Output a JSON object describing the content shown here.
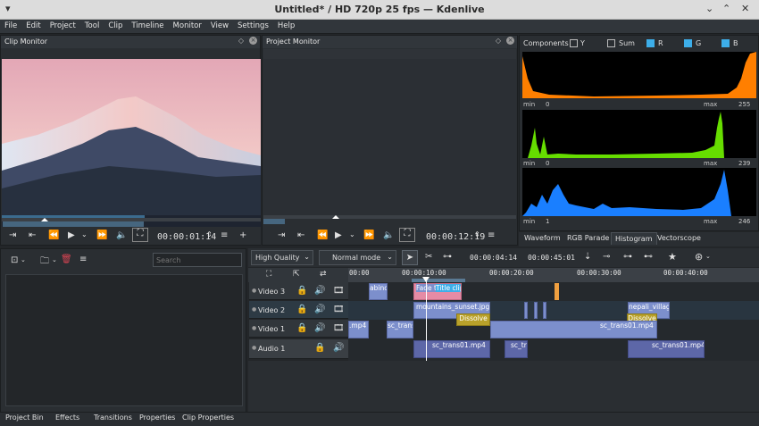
{
  "window": {
    "title": "Untitled* / HD 720p 25 fps — Kdenlive"
  },
  "menu": [
    "File",
    "Edit",
    "Project",
    "Tool",
    "Clip",
    "Timeline",
    "Monitor",
    "View",
    "Settings",
    "Help"
  ],
  "clip_monitor": {
    "title": "Clip Monitor",
    "timecode": "00:00:01:14"
  },
  "project_monitor": {
    "title": "Project Monitor",
    "timecode": "00:00:12:19"
  },
  "scopes": {
    "components_label": "Components",
    "checks": [
      {
        "label": "Y",
        "checked": false
      },
      {
        "label": "Sum",
        "checked": false
      },
      {
        "label": "R",
        "checked": true
      },
      {
        "label": "G",
        "checked": true
      },
      {
        "label": "B",
        "checked": true
      }
    ],
    "channels": [
      {
        "color": "#ff7f00",
        "min_label": "min",
        "min": "0",
        "max_label": "max",
        "max": "255"
      },
      {
        "color": "#66dd00",
        "min_label": "min",
        "min": "0",
        "max_label": "max",
        "max": "239"
      },
      {
        "color": "#1a7fff",
        "min_label": "min",
        "min": "1",
        "max_label": "max",
        "max": "246"
      }
    ],
    "tabs": [
      "Waveform",
      "RGB Parade",
      "Histogram",
      "Vectorscope"
    ],
    "active_tab": "Histogram"
  },
  "bin": {
    "search_placeholder": "Search"
  },
  "timeline_toolbar": {
    "quality": "High Quality",
    "mode": "Normal mode",
    "position": "00:00:04:14",
    "duration": "00:00:45:01"
  },
  "ruler_ticks": [
    "00:00",
    "00:00:10:00",
    "00:00:20:00",
    "00:00:30:00",
    "00:00:40:00"
  ],
  "tracks": [
    {
      "name": "Video 3"
    },
    {
      "name": "Video 2"
    },
    {
      "name": "Video 1"
    },
    {
      "name": "Audio 1"
    }
  ],
  "clips": {
    "v3_a": "abinc",
    "v3_fade": "Fade t",
    "v3_title": "Title clip",
    "v2_mountains": "mountains_sunset.jpg",
    "v2_nepali": "nepali_village.",
    "v1_mp4": ".mp4",
    "v1_sctrans": "sc_trans",
    "v1_sctrans2": "sc_trans01.mp4",
    "a1_1": "sc_trans01.mp4",
    "a1_2": "sc_tr",
    "a1_3": "sc_trans01.mp4",
    "dissolve1": "Dissolve",
    "dissolve2": "Dissolve"
  },
  "bottom_tabs": [
    "Project Bin",
    "Effects",
    "Transitions",
    "Properties",
    "Clip Properties"
  ]
}
